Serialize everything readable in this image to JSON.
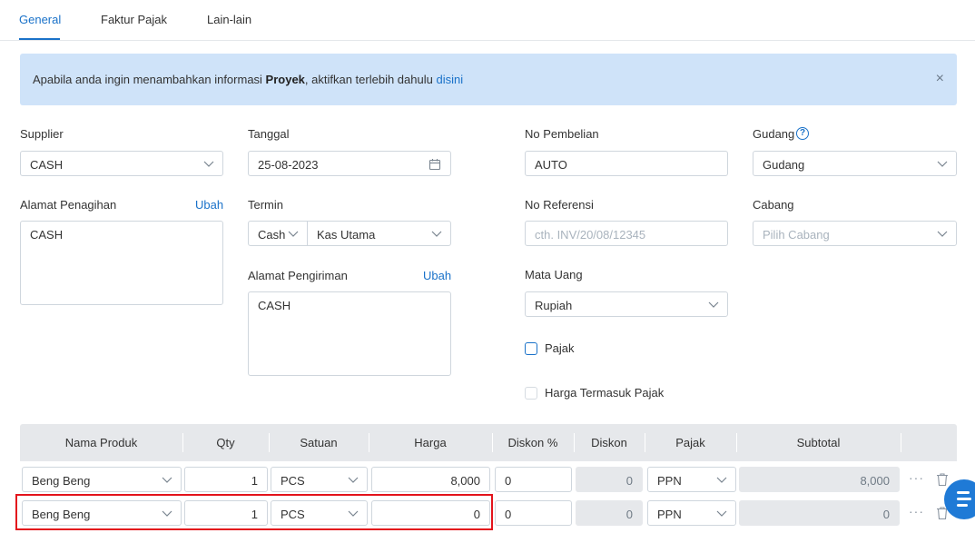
{
  "tabs": [
    {
      "label": "General"
    },
    {
      "label": "Faktur Pajak"
    },
    {
      "label": "Lain-lain"
    }
  ],
  "banner": {
    "text_before": "Apabila anda ingin menambahkan informasi ",
    "bold": "Proyek",
    "text_after": ", aktifkan terlebih dahulu ",
    "link": "disini",
    "close": "×"
  },
  "form": {
    "supplier": {
      "label": "Supplier",
      "value": "CASH"
    },
    "alamat_penagihan": {
      "label": "Alamat Penagihan",
      "edit": "Ubah",
      "value": "CASH"
    },
    "tanggal": {
      "label": "Tanggal",
      "value": "25-08-2023"
    },
    "termin": {
      "label": "Termin",
      "type": "Cash",
      "account": "Kas Utama"
    },
    "alamat_pengiriman": {
      "label": "Alamat Pengiriman",
      "edit": "Ubah",
      "value": "CASH"
    },
    "no_pembelian": {
      "label": "No Pembelian",
      "value": "AUTO"
    },
    "no_referensi": {
      "label": "No Referensi",
      "placeholder": "cth. INV/20/08/12345"
    },
    "mata_uang": {
      "label": "Mata Uang",
      "value": "Rupiah"
    },
    "pajak": {
      "label": "Pajak"
    },
    "harga_termasuk_pajak": {
      "label": "Harga Termasuk Pajak"
    },
    "gudang": {
      "label": "Gudang",
      "value": "Gudang",
      "help": "?"
    },
    "cabang": {
      "label": "Cabang",
      "placeholder": "Pilih Cabang"
    }
  },
  "table": {
    "headers": [
      "Nama Produk",
      "Qty",
      "Satuan",
      "Harga",
      "Diskon %",
      "Diskon",
      "Pajak",
      "Subtotal"
    ],
    "rows": [
      {
        "produk": "Beng Beng",
        "qty": "1",
        "satuan": "PCS",
        "harga": "8,000",
        "diskon_pct": "0",
        "diskon": "0",
        "pajak": "PPN",
        "subtotal": "8,000",
        "more": "···"
      },
      {
        "produk": "Beng Beng",
        "qty": "1",
        "satuan": "PCS",
        "harga": "0",
        "diskon_pct": "0",
        "diskon": "0",
        "pajak": "PPN",
        "subtotal": "0",
        "more": "···"
      }
    ]
  },
  "icons": [
    "chevron-down-icon",
    "calendar-icon",
    "help-icon",
    "close-icon",
    "trash-icon",
    "more-icon",
    "menu-icon"
  ],
  "colors": {
    "accent": "#1a72c9",
    "banner_bg": "#cfe3f9",
    "header_bg": "#e6e8eb",
    "highlight": "#e3141c",
    "fab": "#1f7ad6"
  }
}
